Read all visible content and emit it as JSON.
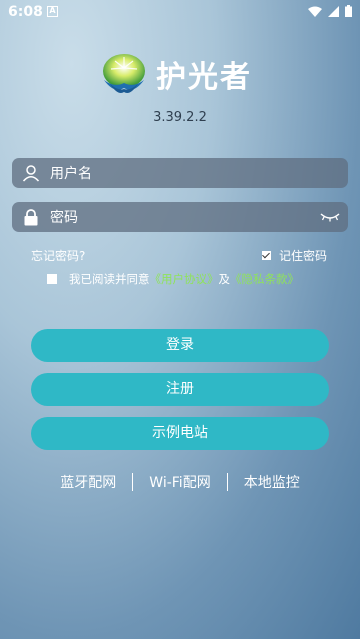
{
  "status": {
    "time": "6:08",
    "notif_letter": "A"
  },
  "app": {
    "name": "护光者",
    "version": "3.39.2.2"
  },
  "login": {
    "username_placeholder": "用户名",
    "password_placeholder": "密码",
    "forgot_label": "忘记密码?",
    "remember_label": "记住密码",
    "remember_checked": true,
    "agree_checked": false,
    "agree_prefix": "我已阅读并同意",
    "user_agreement": "《用户协议》",
    "agree_and": "及",
    "privacy_policy": "《隐私条款》"
  },
  "buttons": {
    "login": "登录",
    "register": "注册",
    "demo": "示例电站"
  },
  "links": {
    "bluetooth": "蓝牙配网",
    "wifi": "Wi-Fi配网",
    "local": "本地监控"
  },
  "colors": {
    "accent": "#2fb8c6",
    "link": "#8fe35a"
  }
}
